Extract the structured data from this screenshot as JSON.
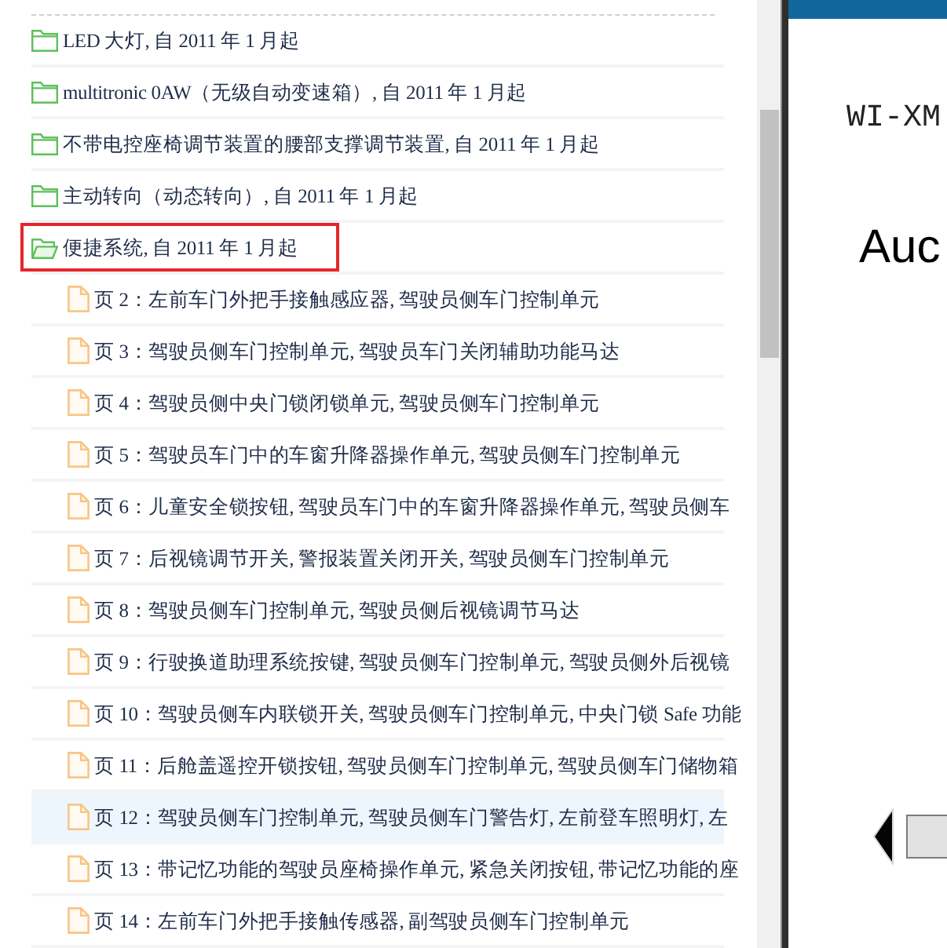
{
  "tree": {
    "items": [
      {
        "kind": "folder",
        "label": "LED 大灯, 自 2011 年 1 月起",
        "selected": false,
        "expanded": false
      },
      {
        "kind": "folder",
        "label": "multitronic 0AW（无级自动变速箱）, 自 2011 年 1 月起",
        "selected": false,
        "expanded": false
      },
      {
        "kind": "folder",
        "label": "不带电控座椅调节装置的腰部支撑调节装置, 自 2011 年 1 月起",
        "selected": false,
        "expanded": false
      },
      {
        "kind": "folder",
        "label": "主动转向（动态转向）, 自 2011 年 1 月起",
        "selected": false,
        "expanded": false
      },
      {
        "kind": "folder",
        "label": "便捷系统, 自 2011 年 1 月起",
        "selected": true,
        "expanded": true,
        "children": [
          {
            "kind": "page",
            "label": "页 2：左前车门外把手接触感应器, 驾驶员侧车门控制单元",
            "selected": false,
            "highlighted": false
          },
          {
            "kind": "page",
            "label": "页 3：驾驶员侧车门控制单元, 驾驶员车门关闭辅助功能马达",
            "selected": false,
            "highlighted": false
          },
          {
            "kind": "page",
            "label": "页 4：驾驶员侧中央门锁闭锁单元, 驾驶员侧车门控制单元",
            "selected": false,
            "highlighted": false
          },
          {
            "kind": "page",
            "label": "页 5：驾驶员车门中的车窗升降器操作单元, 驾驶员侧车门控制单元",
            "selected": false,
            "highlighted": false
          },
          {
            "kind": "page",
            "label": "页 6：儿童安全锁按钮, 驾驶员车门中的车窗升降器操作单元, 驾驶员侧车",
            "selected": false,
            "highlighted": false
          },
          {
            "kind": "page",
            "label": "页 7：后视镜调节开关, 警报装置关闭开关, 驾驶员侧车门控制单元",
            "selected": false,
            "highlighted": false
          },
          {
            "kind": "page",
            "label": "页 8：驾驶员侧车门控制单元, 驾驶员侧后视镜调节马达",
            "selected": false,
            "highlighted": false
          },
          {
            "kind": "page",
            "label": "页 9：行驶换道助理系统按键, 驾驶员侧车门控制单元, 驾驶员侧外后视镜",
            "selected": false,
            "highlighted": false
          },
          {
            "kind": "page",
            "label": "页 10：驾驶员侧车内联锁开关, 驾驶员侧车门控制单元, 中央门锁 Safe 功能",
            "selected": false,
            "highlighted": false
          },
          {
            "kind": "page",
            "label": "页 11：后舱盖遥控开锁按钮, 驾驶员侧车门控制单元, 驾驶员侧车门储物箱",
            "selected": false,
            "highlighted": false
          },
          {
            "kind": "page",
            "label": "页 12：驾驶员侧车门控制单元, 驾驶员侧车门警告灯, 左前登车照明灯, 左",
            "selected": false,
            "highlighted": true
          },
          {
            "kind": "page",
            "label": "页 13：带记忆功能的驾驶员座椅操作单元, 紧急关闭按钮, 带记忆功能的座",
            "selected": false,
            "highlighted": false
          },
          {
            "kind": "page",
            "label": "页 14：左前车门外把手接触传感器, 副驾驶员侧车门控制单元",
            "selected": false,
            "highlighted": false
          }
        ]
      }
    ]
  },
  "viewer": {
    "heading": "WI-XM",
    "title": "Auc"
  }
}
